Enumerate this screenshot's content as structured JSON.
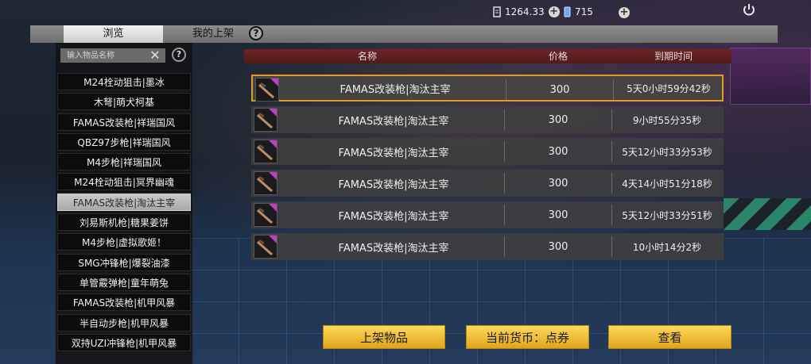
{
  "topbar": {
    "currency1_value": "1264.33",
    "currency2_value": "715",
    "plus_symbol": "+",
    "icons": [
      "coin-card-icon",
      "plus-icon",
      "gem-icon",
      "plus-icon",
      "plus-icon",
      "power-icon"
    ]
  },
  "tabs": {
    "browse": "浏览",
    "my_listings": "我的上架",
    "help": "?"
  },
  "sidebar": {
    "search_placeholder": "输入物品名称",
    "clear_symbol": "✕",
    "help": "?",
    "items": [
      {
        "label": "M24栓动狙击|墨冰"
      },
      {
        "label": "木弩|萌犬柯基"
      },
      {
        "label": "FAMAS改装枪|祥瑞国风"
      },
      {
        "label": "QBZ97步枪|祥瑞国风"
      },
      {
        "label": "M4步枪|祥瑞国风"
      },
      {
        "label": "M24栓动狙击|冥界幽魂"
      },
      {
        "label": "FAMAS改装枪|淘汰主宰"
      },
      {
        "label": "刘易斯机枪|糖果姜饼"
      },
      {
        "label": "M4步枪|虚拟歌姬！"
      },
      {
        "label": "SMG冲锋枪|爆裂油漆"
      },
      {
        "label": "单管霰弹枪|童年萌兔"
      },
      {
        "label": "FAMAS改装枪|机甲风暴"
      },
      {
        "label": "半自动步枪|机甲风暴"
      },
      {
        "label": "双持UZI冲锋枪|机甲风暴"
      }
    ],
    "selected_index": 6
  },
  "table": {
    "headers": {
      "name": "名称",
      "price": "价格",
      "expiry": "到期时间"
    },
    "rows": [
      {
        "name": "FAMAS改装枪|淘汰主宰",
        "price": "300",
        "expiry": "5天0小时59分42秒"
      },
      {
        "name": "FAMAS改装枪|淘汰主宰",
        "price": "300",
        "expiry": "9小时55分35秒"
      },
      {
        "name": "FAMAS改装枪|淘汰主宰",
        "price": "300",
        "expiry": "5天12小时33分53秒"
      },
      {
        "name": "FAMAS改装枪|淘汰主宰",
        "price": "300",
        "expiry": "4天14小时51分18秒"
      },
      {
        "name": "FAMAS改装枪|淘汰主宰",
        "price": "300",
        "expiry": "5天12小时33分51秒"
      },
      {
        "name": "FAMAS改装枪|淘汰主宰",
        "price": "300",
        "expiry": "10小时14分2秒"
      }
    ],
    "selected_row": 0,
    "accent_color": "#e09a2a",
    "header_color": "#6e2424",
    "thumb_corner_color": "#c03cc0"
  },
  "buttons": {
    "list_item": "上架物品",
    "current_currency": "当前货币：点券",
    "view": "查看"
  }
}
